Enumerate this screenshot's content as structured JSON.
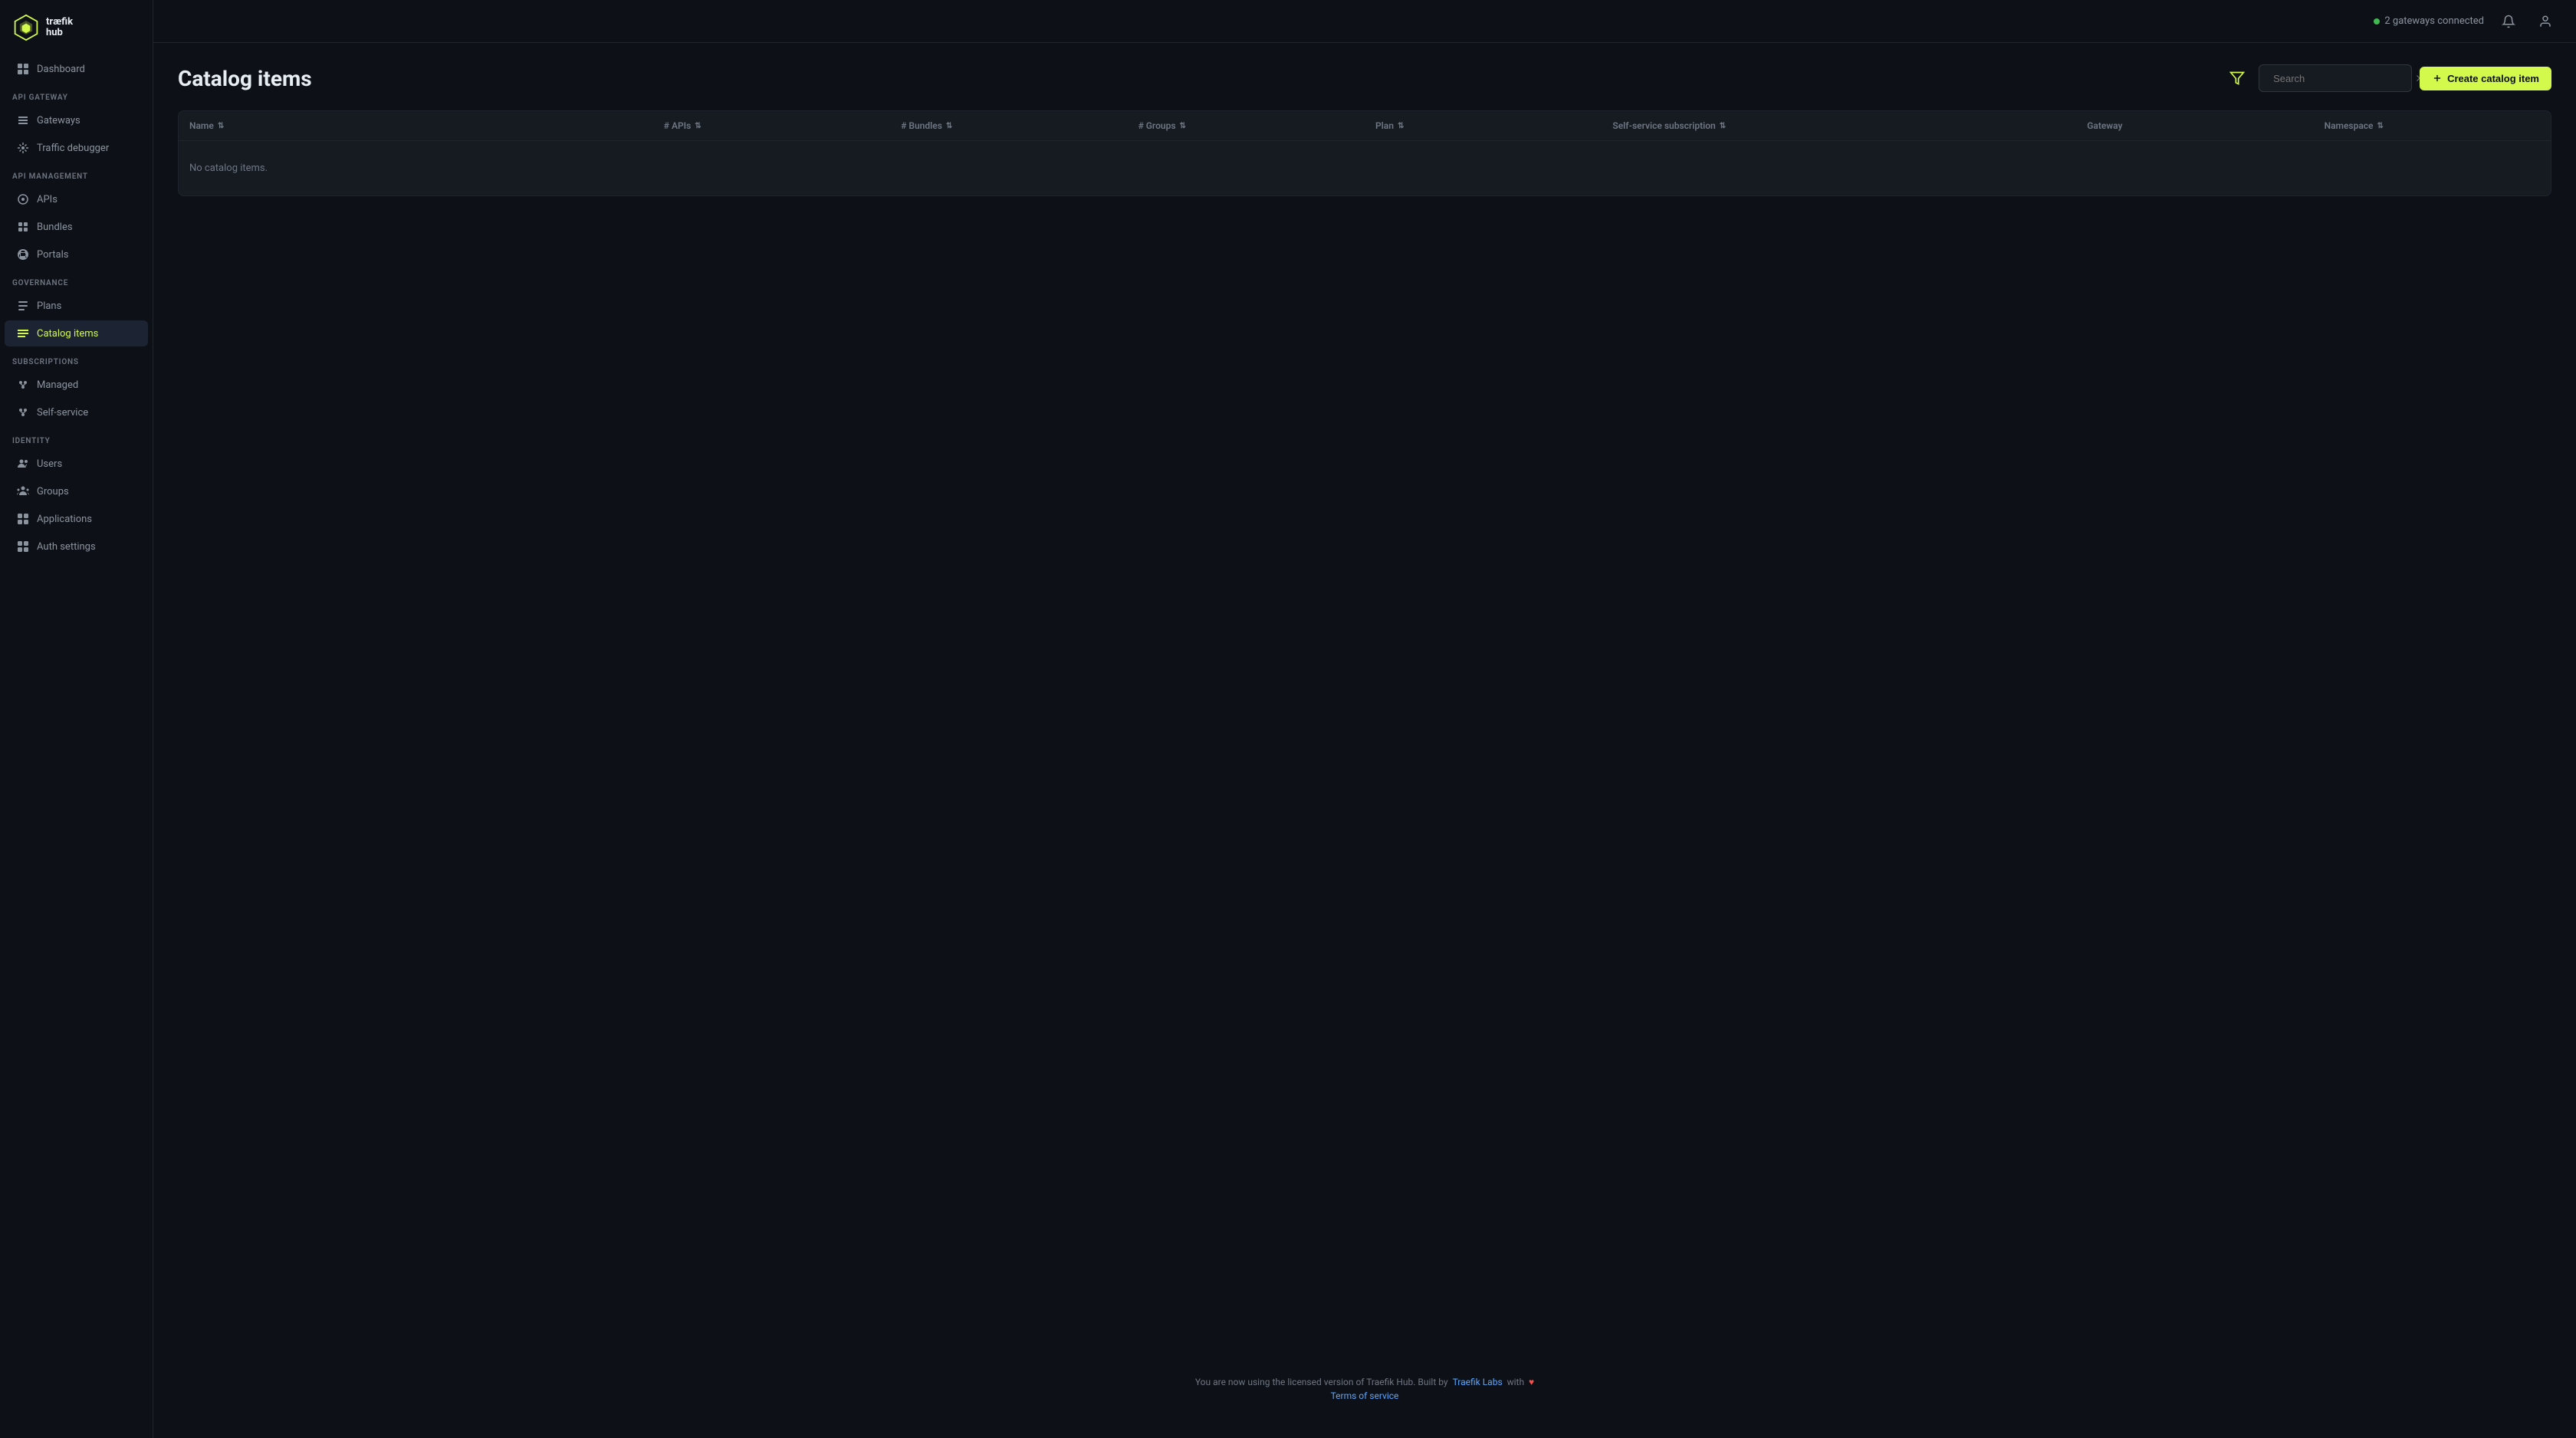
{
  "logo": {
    "line1": "træfik",
    "line2": "hub"
  },
  "header": {
    "gateway_status": "2 gateways connected",
    "notification_icon": "bell",
    "user_icon": "user"
  },
  "sidebar": {
    "nav_sections": [
      {
        "label": "",
        "items": [
          {
            "id": "dashboard",
            "label": "Dashboard",
            "icon": "dashboard"
          }
        ]
      },
      {
        "label": "API GATEWAY",
        "items": [
          {
            "id": "gateways",
            "label": "Gateways",
            "icon": "gateways"
          },
          {
            "id": "traffic-debugger",
            "label": "Traffic debugger",
            "icon": "traffic"
          }
        ]
      },
      {
        "label": "API MANAGEMENT",
        "items": [
          {
            "id": "apis",
            "label": "APIs",
            "icon": "apis"
          },
          {
            "id": "bundles",
            "label": "Bundles",
            "icon": "bundles"
          },
          {
            "id": "portals",
            "label": "Portals",
            "icon": "portals"
          }
        ]
      },
      {
        "label": "GOVERNANCE",
        "items": [
          {
            "id": "plans",
            "label": "Plans",
            "icon": "plans"
          },
          {
            "id": "catalog-items",
            "label": "Catalog items",
            "icon": "catalog",
            "active": true
          }
        ]
      },
      {
        "label": "SUBSCRIPTIONS",
        "items": [
          {
            "id": "managed",
            "label": "Managed",
            "icon": "managed"
          },
          {
            "id": "self-service",
            "label": "Self-service",
            "icon": "self-service"
          }
        ]
      },
      {
        "label": "IDENTITY",
        "items": [
          {
            "id": "users",
            "label": "Users",
            "icon": "users"
          },
          {
            "id": "groups",
            "label": "Groups",
            "icon": "groups"
          },
          {
            "id": "applications",
            "label": "Applications",
            "icon": "applications"
          },
          {
            "id": "auth-settings",
            "label": "Auth settings",
            "icon": "auth"
          }
        ]
      }
    ]
  },
  "page": {
    "title": "Catalog items",
    "search_placeholder": "Search",
    "create_button_label": "Create catalog item",
    "table": {
      "columns": [
        {
          "label": "Name",
          "sortable": true
        },
        {
          "label": "# APIs",
          "sortable": true
        },
        {
          "label": "# Bundles",
          "sortable": true
        },
        {
          "label": "# Groups",
          "sortable": true
        },
        {
          "label": "Plan",
          "sortable": true
        },
        {
          "label": "Self-service subscription",
          "sortable": true
        },
        {
          "label": "Gateway",
          "sortable": false
        },
        {
          "label": "Namespace",
          "sortable": true
        }
      ],
      "empty_message": "No catalog items."
    }
  },
  "footer": {
    "text_before_link": "You are now using the licensed version of Traefik Hub. Built by",
    "link_label": "Traefik Labs",
    "text_after_link": "with",
    "terms_label": "Terms of service"
  }
}
